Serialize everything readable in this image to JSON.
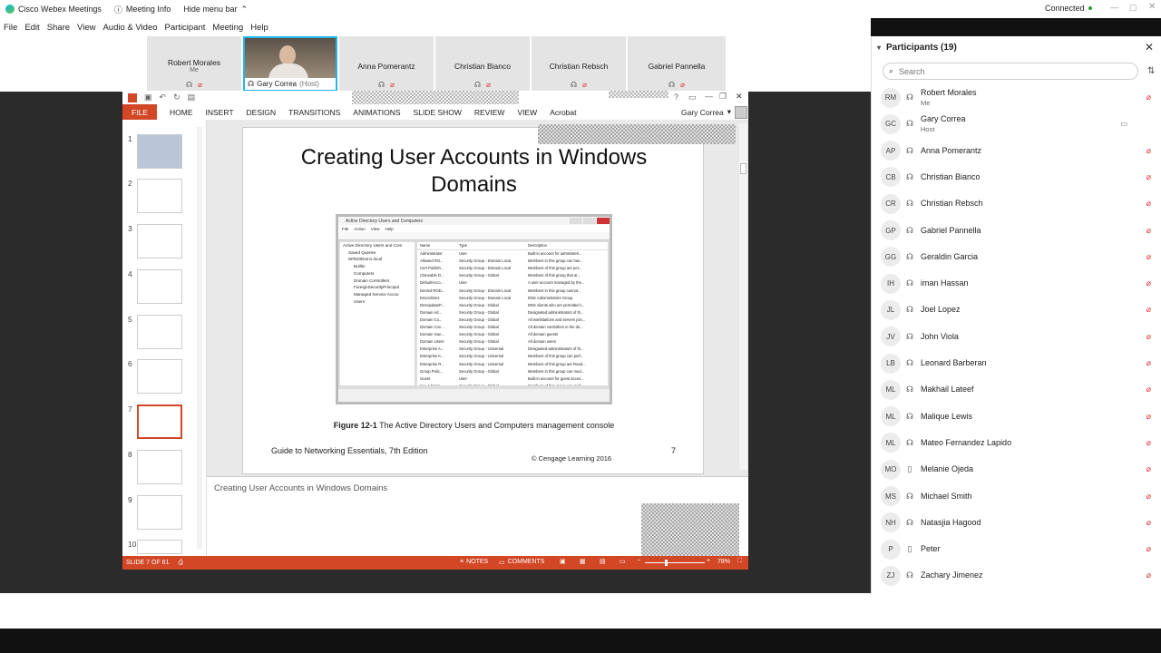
{
  "window": {
    "app_title": "Cisco Webex Meetings",
    "meeting_info": "Meeting Info",
    "hide_menu_bar": "Hide menu bar",
    "status": "Connected",
    "status_color": "#2ca02c"
  },
  "menu": [
    "File",
    "Edit",
    "Share",
    "View",
    "Audio & Video",
    "Participant",
    "Meeting",
    "Help"
  ],
  "video_strip": [
    {
      "name": "Robert Morales",
      "sub": "Me"
    },
    {
      "name": "Gary Correa",
      "sub": "(Host)",
      "active": true
    },
    {
      "name": "Anna Pomerantz",
      "sub": ""
    },
    {
      "name": "Christian Bianco",
      "sub": ""
    },
    {
      "name": "Christian Rebsch",
      "sub": ""
    },
    {
      "name": "Gabriel Pannella",
      "sub": ""
    }
  ],
  "ppt": {
    "tabs": [
      "FILE",
      "HOME",
      "INSERT",
      "DESIGN",
      "TRANSITIONS",
      "ANIMATIONS",
      "SLIDE SHOW",
      "REVIEW",
      "VIEW",
      "Acrobat"
    ],
    "user": "Gary Correa",
    "slide_numbers": [
      "1",
      "2",
      "3",
      "4",
      "5",
      "6",
      "7",
      "8",
      "9",
      "10"
    ],
    "selected_slide": 7,
    "slide": {
      "title_line1": "Creating User Accounts in Windows",
      "title_line2": "Domains",
      "figure_title": "Active Directory Users and Computers",
      "figure_menu": [
        "File",
        "Action",
        "View",
        "Help"
      ],
      "tree": [
        "Active Directory Users and Com",
        "Saved Queries",
        "WIN10Dom1.local",
        "Builtin",
        "Computers",
        "Domain Controllers",
        "ForeignSecurityPrincipal",
        "Managed Service Accou",
        "Users"
      ],
      "columns": [
        "Name",
        "Type",
        "Description"
      ],
      "rows": [
        [
          "Administrator",
          "User",
          "Built-in account for administeri..."
        ],
        [
          "Allowed RO...",
          "Security Group - Domain Local",
          "Members in this group can hav..."
        ],
        [
          "Cert Publish...",
          "Security Group - Domain Local",
          "Members of this group are per..."
        ],
        [
          "Cloneable D...",
          "Security Group - Global",
          "Members of this group that ar..."
        ],
        [
          "DefaultAcco...",
          "User",
          "A user account managed by the..."
        ],
        [
          "Denied ROD...",
          "Security Group - Domain Local",
          "Members in this group cannot..."
        ],
        [
          "DnsAdmins",
          "Security Group - Domain Local",
          "DNS Administrators Group"
        ],
        [
          "DnsUpdateP...",
          "Security Group - Global",
          "DNS clients who are permitted t..."
        ],
        [
          "Domain Ad...",
          "Security Group - Global",
          "Designated administrators of th..."
        ],
        [
          "Domain Co...",
          "Security Group - Global",
          "All workstations and servers join..."
        ],
        [
          "Domain Con...",
          "Security Group - Global",
          "All domain controllers in the do..."
        ],
        [
          "Domain Gue...",
          "Security Group - Global",
          "All domain guests"
        ],
        [
          "Domain Users",
          "Security Group - Global",
          "All domain users"
        ],
        [
          "Enterprise A...",
          "Security Group - Universal",
          "Designated administrators of th..."
        ],
        [
          "Enterprise K...",
          "Security Group - Universal",
          "Members of this group can perf..."
        ],
        [
          "Enterprise R...",
          "Security Group - Universal",
          "Members of this group are Read..."
        ],
        [
          "Group Polic...",
          "Security Group - Global",
          "Members in this group can mod..."
        ],
        [
          "Guest",
          "User",
          "Built-in account for guest acces..."
        ],
        [
          "Key Admins",
          "Security Group - Global",
          "Members of this group can perf..."
        ]
      ],
      "caption_bold": "Figure 12-1",
      "caption_rest": " The Active Directory Users and Computers management console",
      "footer_left": "Guide to Networking Essentials, 7th Edition",
      "footer_center": "© Cengage Learning  2016",
      "footer_num": "7"
    },
    "notes": "Creating User Accounts in Windows Domains",
    "status": {
      "slide_of": "SLIDE 7 OF 61",
      "notes_btn": "NOTES",
      "comments_btn": "COMMENTS",
      "zoom": "78%"
    }
  },
  "participants": {
    "title": "Participants (19)",
    "search_placeholder": "Search",
    "list": [
      {
        "initials": "RM",
        "name": "Robert Morales",
        "sub": "Me",
        "icon": "audio"
      },
      {
        "initials": "GC",
        "name": "Gary Correa",
        "sub": "Host",
        "icon": "audio"
      },
      {
        "initials": "AP",
        "name": "Anna Pomerantz",
        "sub": "",
        "icon": "audio"
      },
      {
        "initials": "CB",
        "name": "Christian Bianco",
        "sub": "",
        "icon": "audio"
      },
      {
        "initials": "CR",
        "name": "Christian Rebsch",
        "sub": "",
        "icon": "audio"
      },
      {
        "initials": "GP",
        "name": "Gabriel Pannella",
        "sub": "",
        "icon": "audio"
      },
      {
        "initials": "GG",
        "name": "Geraldin Garcia",
        "sub": "",
        "icon": "audio"
      },
      {
        "initials": "IH",
        "name": "iman Hassan",
        "sub": "",
        "icon": "audio"
      },
      {
        "initials": "JL",
        "name": "Joel Lopez",
        "sub": "",
        "icon": "audio"
      },
      {
        "initials": "JV",
        "name": "John Viola",
        "sub": "",
        "icon": "audio"
      },
      {
        "initials": "LB",
        "name": "Leonard Barberan",
        "sub": "",
        "icon": "audio"
      },
      {
        "initials": "ML",
        "name": "Makhail Lateef",
        "sub": "",
        "icon": "audio"
      },
      {
        "initials": "ML",
        "name": "Malique Lewis",
        "sub": "",
        "icon": "audio"
      },
      {
        "initials": "ML",
        "name": "Mateo Fernandez Lapido",
        "sub": "",
        "icon": "audio"
      },
      {
        "initials": "MO",
        "name": "Melanie Ojeda",
        "sub": "",
        "icon": "phone"
      },
      {
        "initials": "MS",
        "name": "Michael Smith",
        "sub": "",
        "icon": "audio"
      },
      {
        "initials": "NH",
        "name": "Natasjia Hagood",
        "sub": "",
        "icon": "audio"
      },
      {
        "initials": "P",
        "name": "Peter",
        "sub": "",
        "icon": "phone"
      },
      {
        "initials": "ZJ",
        "name": "Zachary Jimenez",
        "sub": "",
        "icon": "audio"
      }
    ]
  }
}
